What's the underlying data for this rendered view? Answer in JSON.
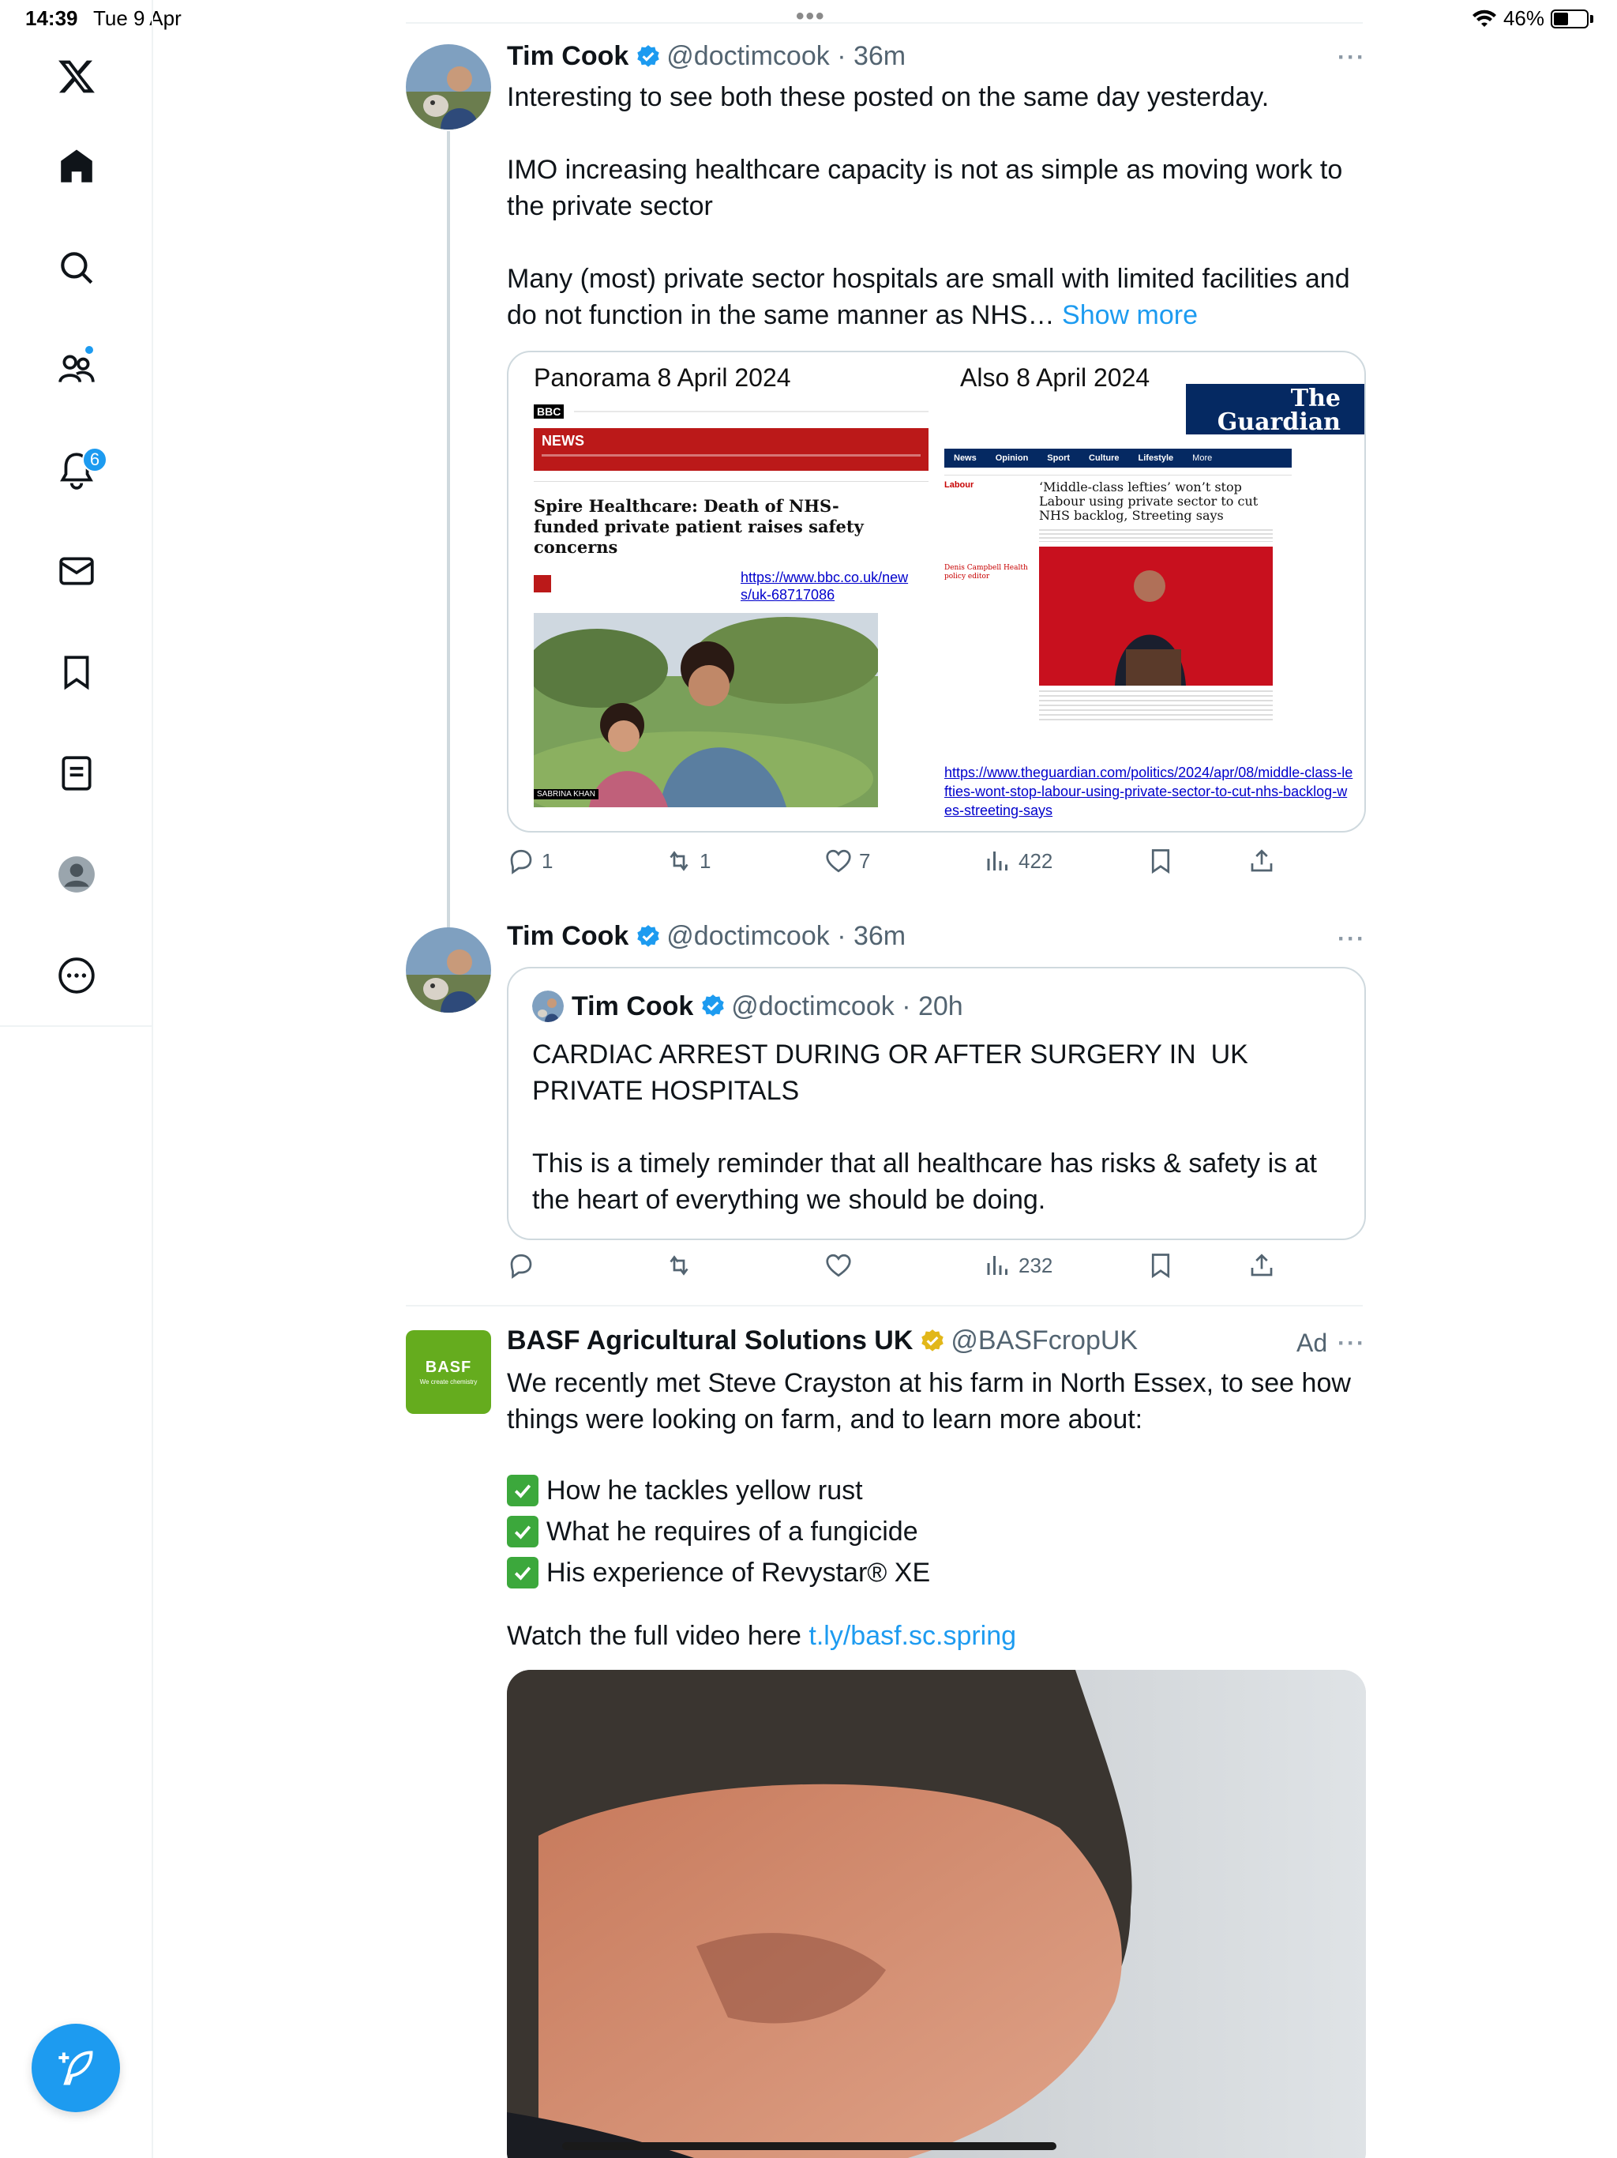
{
  "status_bar": {
    "time": "14:39",
    "date": "Tue 9 Apr",
    "battery_percent": "46%",
    "battery_level": 0.46
  },
  "sidebar": {
    "logo": "x-logo-icon",
    "items": [
      {
        "name": "home",
        "icon": "home-icon"
      },
      {
        "name": "explore",
        "icon": "search-icon"
      },
      {
        "name": "communities",
        "icon": "people-icon"
      },
      {
        "name": "notifications",
        "icon": "bell-icon",
        "badge": "6"
      },
      {
        "name": "messages",
        "icon": "envelope-icon"
      },
      {
        "name": "bookmarks",
        "icon": "bookmark-icon"
      },
      {
        "name": "lists",
        "icon": "list-icon"
      },
      {
        "name": "profile",
        "icon": "avatar-icon"
      },
      {
        "name": "more",
        "icon": "more-circle-icon"
      }
    ],
    "compose_icon": "feather-plus-icon"
  },
  "feed": {
    "tweets": [
      {
        "name": "Tim Cook",
        "handle": "@doctimcook",
        "time": "36m",
        "text_p1": "Interesting to see both these posted on the same day yesterday.",
        "text_p2": "IMO increasing healthcare capacity is not as simple as moving work to the private sector",
        "text_p3": "Many (most) private sector hospitals are small with limited facilities and do not function in the same manner as NHS…",
        "show_more": "Show more",
        "image": {
          "left_caption": "Panorama  8 April 2024",
          "right_caption": "Also 8 April 2024",
          "bbc": {
            "logo": "BBC",
            "nav": "NEWS",
            "headline": "Spire Healthcare: Death of NHS-funded private patient raises safety concerns",
            "url": "https://www.bbc.co.uk/news/uk-68717086",
            "photo_label": "SABRINA KHAN"
          },
          "guardian": {
            "logo": "The Guardian",
            "nav": [
              "News",
              "Opinion",
              "Sport",
              "Culture",
              "Lifestyle",
              "More"
            ],
            "section": "Labour",
            "headline": "‘Middle-class lefties’ won’t stop Labour using private sector to cut NHS backlog, Streeting says",
            "byline": "Denis Campbell Health policy editor",
            "url": "https://www.theguardian.com/politics/2024/apr/08/middle-class-lefties-wont-stop-labour-using-private-sector-to-cut-nhs-backlog-wes-streeting-says"
          }
        },
        "replies": "1",
        "retweets": "1",
        "likes": "7",
        "views": "422"
      },
      {
        "name": "Tim Cook",
        "handle": "@doctimcook",
        "time": "36m",
        "quote": {
          "name": "Tim Cook",
          "handle": "@doctimcook",
          "time": "20h",
          "text_p1": "CARDIAC ARREST DURING OR AFTER SURGERY IN  UK PRIVATE HOSPITALS",
          "text_p2": "This is a timely reminder that all healthcare has risks & safety is at the heart of everything we should be doing."
        },
        "views": "232"
      },
      {
        "name": "BASF Agricultural Solutions UK",
        "handle": "@BASFcropUK",
        "ad_label": "Ad",
        "avatar_text": "BASF",
        "avatar_subtext": "We create chemistry",
        "text_p1": "We recently met Steve Crayston at his farm in North Essex, to see how things were looking on farm, and to learn more about:",
        "bullets": [
          "How he tackles yellow rust",
          "What he requires of a fungicide",
          "His experience of Revystar® XE"
        ],
        "text_p2": "Watch the full video here ",
        "link": "t.ly/basf.sc.spring"
      }
    ]
  },
  "colors": {
    "accent": "#1d9bf0",
    "text": "#0f1419",
    "secondary": "#536471",
    "border": "#cfd9de",
    "basf_green": "#65ac1e",
    "bbc_red": "#bb1919",
    "guardian_blue": "#052962"
  }
}
